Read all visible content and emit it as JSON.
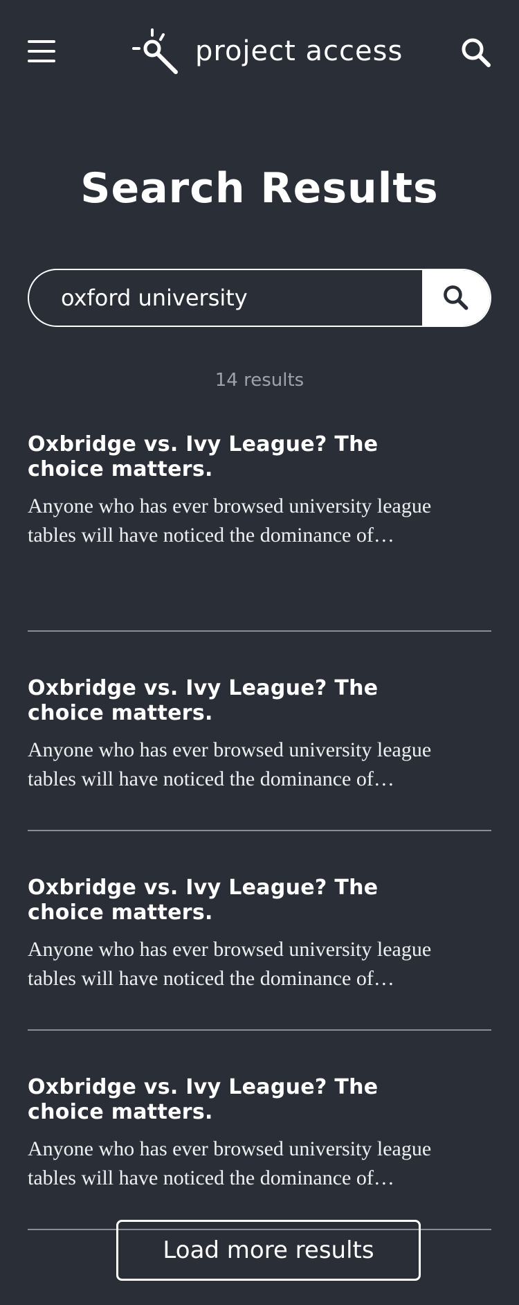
{
  "header": {
    "menu_icon": "hamburger-menu-icon",
    "logo_icon": "project-access-logo-icon",
    "logo_text": "project access",
    "search_icon": "search-icon"
  },
  "page": {
    "title": "Search Results"
  },
  "search": {
    "value": "oxford university",
    "submit_icon": "search-icon"
  },
  "results_count": "14 results",
  "results": [
    {
      "title": "Oxbridge vs. Ivy League? The choice matters.",
      "excerpt": "Anyone who has ever browsed university league tables will have noticed the dominance of…"
    },
    {
      "title": "Oxbridge vs. Ivy League? The choice matters.",
      "excerpt": "Anyone who has ever browsed university league tables will have noticed the dominance of…"
    },
    {
      "title": "Oxbridge vs. Ivy League? The choice matters.",
      "excerpt": "Anyone who has ever browsed university league tables will have noticed the dominance of…"
    },
    {
      "title": "Oxbridge vs. Ivy League? The choice matters.",
      "excerpt": "Anyone who has ever browsed university league tables will have noticed the dominance of…"
    }
  ],
  "load_more_label": "Load more results",
  "colors": {
    "background": "#2a2e37",
    "text": "#ffffff",
    "muted": "#9ea3ab",
    "divider": "#8a8f97"
  }
}
